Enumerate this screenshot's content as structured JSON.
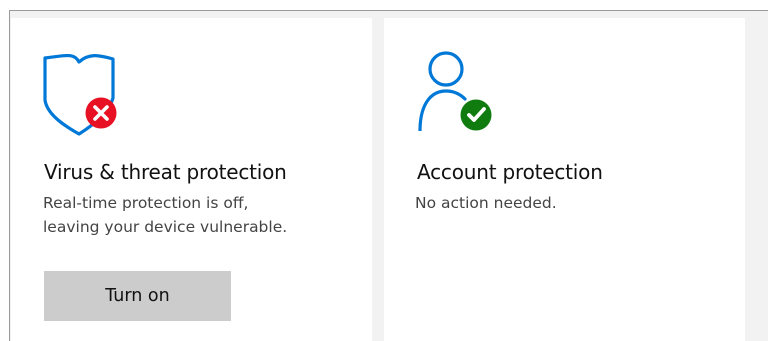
{
  "virus_tile": {
    "title": "Virus & threat protection",
    "description_lines": [
      "Real-time protection is off,",
      "leaving your device vulnerable."
    ],
    "button_label": "Turn on",
    "icon": "shield-icon",
    "status_icon": "error-x-icon",
    "status_color": "#e81123"
  },
  "account_tile": {
    "title": "Account protection",
    "description_lines": [
      "No action needed."
    ],
    "icon": "person-icon",
    "status_icon": "checkmark-icon",
    "status_color": "#107c10"
  },
  "accent_color": "#0078d7"
}
